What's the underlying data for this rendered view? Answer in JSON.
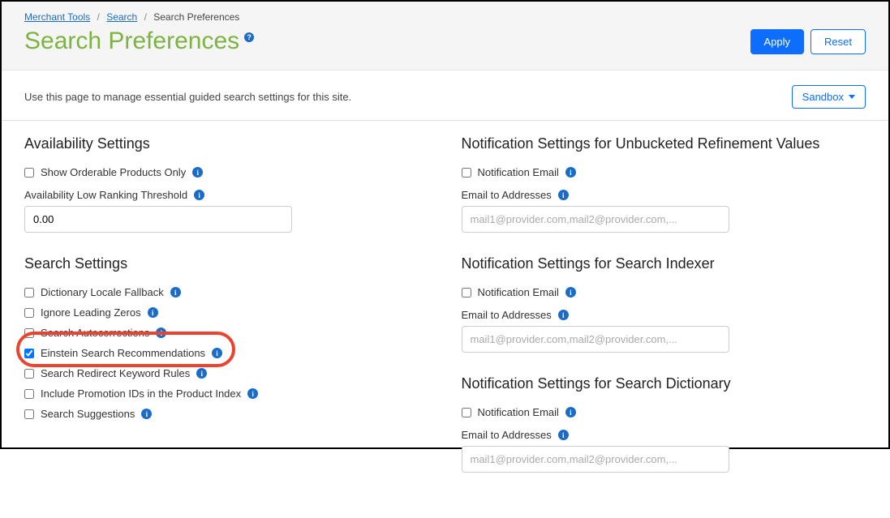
{
  "breadcrumb": {
    "merchant_tools": "Merchant Tools",
    "search": "Search",
    "current": "Search Preferences"
  },
  "title": "Search Preferences",
  "buttons": {
    "apply": "Apply",
    "reset": "Reset"
  },
  "intro": "Use this page to manage essential guided search settings for this site.",
  "env_dropdown": "Sandbox",
  "left": {
    "availability": {
      "heading": "Availability Settings",
      "show_orderable": "Show Orderable Products Only",
      "low_ranking_label": "Availability Low Ranking Threshold",
      "low_ranking_value": "0.00"
    },
    "search_settings": {
      "heading": "Search Settings",
      "dict_fallback": "Dictionary Locale Fallback",
      "ignore_zeros": "Ignore Leading Zeros",
      "autocorrect": "Search Autocorrections",
      "einstein": "Einstein Search Recommendations",
      "redirect_rules": "Search Redirect Keyword Rules",
      "promo_ids": "Include Promotion IDs in the Product Index",
      "suggestions": "Search Suggestions"
    }
  },
  "right": {
    "unbucketed": {
      "heading": "Notification Settings for Unbucketed Refinement Values",
      "notif_email": "Notification Email",
      "email_to": "Email to Addresses",
      "placeholder": "mail1@provider.com,mail2@provider.com,..."
    },
    "indexer": {
      "heading": "Notification Settings for Search Indexer",
      "notif_email": "Notification Email",
      "email_to": "Email to Addresses",
      "placeholder": "mail1@provider.com,mail2@provider.com,..."
    },
    "dictionary": {
      "heading": "Notification Settings for Search Dictionary",
      "notif_email": "Notification Email",
      "email_to": "Email to Addresses",
      "placeholder": "mail1@provider.com,mail2@provider.com,..."
    }
  }
}
